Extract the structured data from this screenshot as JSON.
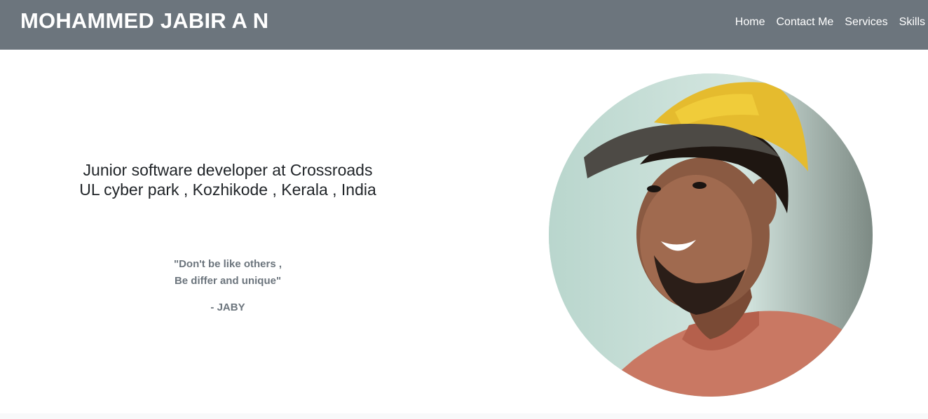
{
  "navbar": {
    "brand": "MOHAMMED JABIR A N",
    "links": [
      "Home",
      "Contact Me",
      "Services",
      "Skills"
    ]
  },
  "hero": {
    "line1": "Junior software developer at Crossroads",
    "line2": "UL cyber park , Kozhikode , Kerala , India"
  },
  "quote": {
    "line1": "\"Don't be like others ,",
    "line2": "Be differ and unique\"",
    "author": "- JABY"
  },
  "colors": {
    "navbar_bg": "#6c757d",
    "text_dark": "#212529",
    "text_muted": "#6c757d"
  },
  "avatar": {
    "icon": "profile-photo"
  }
}
